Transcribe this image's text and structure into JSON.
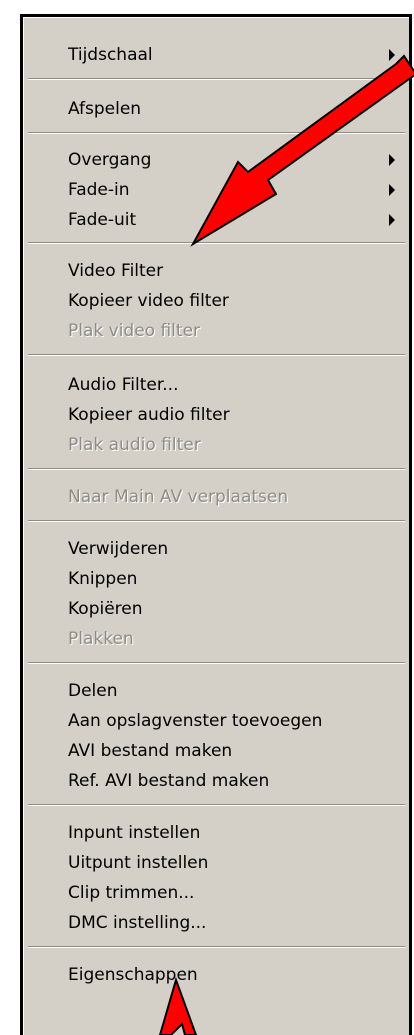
{
  "menu": {
    "items": [
      {
        "label": "Tijdschaal",
        "submenu": true,
        "disabled": false
      },
      {
        "label": "Afspelen",
        "submenu": false,
        "disabled": false
      },
      {
        "label": "Overgang",
        "submenu": true,
        "disabled": false
      },
      {
        "label": "Fade-in",
        "submenu": true,
        "disabled": false
      },
      {
        "label": "Fade-uit",
        "submenu": true,
        "disabled": false
      },
      {
        "label": "Video Filter",
        "submenu": false,
        "disabled": false
      },
      {
        "label": "Kopieer video filter",
        "submenu": false,
        "disabled": false
      },
      {
        "label": "Plak video filter",
        "submenu": false,
        "disabled": true
      },
      {
        "label": "Audio Filter...",
        "submenu": false,
        "disabled": false
      },
      {
        "label": "Kopieer audio filter",
        "submenu": false,
        "disabled": false
      },
      {
        "label": "Plak audio filter",
        "submenu": false,
        "disabled": true
      },
      {
        "label": "Naar Main AV verplaatsen",
        "submenu": false,
        "disabled": true
      },
      {
        "label": "Verwijderen",
        "submenu": false,
        "disabled": false
      },
      {
        "label": "Knippen",
        "submenu": false,
        "disabled": false
      },
      {
        "label": "Kopiëren",
        "submenu": false,
        "disabled": false
      },
      {
        "label": "Plakken",
        "submenu": false,
        "disabled": true
      },
      {
        "label": "Delen",
        "submenu": false,
        "disabled": false
      },
      {
        "label": "Aan opslagvenster toevoegen",
        "submenu": false,
        "disabled": false
      },
      {
        "label": "AVI bestand maken",
        "submenu": false,
        "disabled": false
      },
      {
        "label": "Ref. AVI bestand maken",
        "submenu": false,
        "disabled": false
      },
      {
        "label": "Inpunt instellen",
        "submenu": false,
        "disabled": false
      },
      {
        "label": "Uitpunt instellen",
        "submenu": false,
        "disabled": false
      },
      {
        "label": "Clip trimmen...",
        "submenu": false,
        "disabled": false
      },
      {
        "label": "DMC instelling...",
        "submenu": false,
        "disabled": false
      },
      {
        "label": "Eigenschappen",
        "submenu": false,
        "disabled": false
      }
    ]
  },
  "annotations": {
    "arrow_color": "#ff0000",
    "arrow_outline": "#000000",
    "arrows": [
      "pointer-arrow-to-video-filter",
      "pointer-arrow-to-eigenschappen"
    ]
  }
}
